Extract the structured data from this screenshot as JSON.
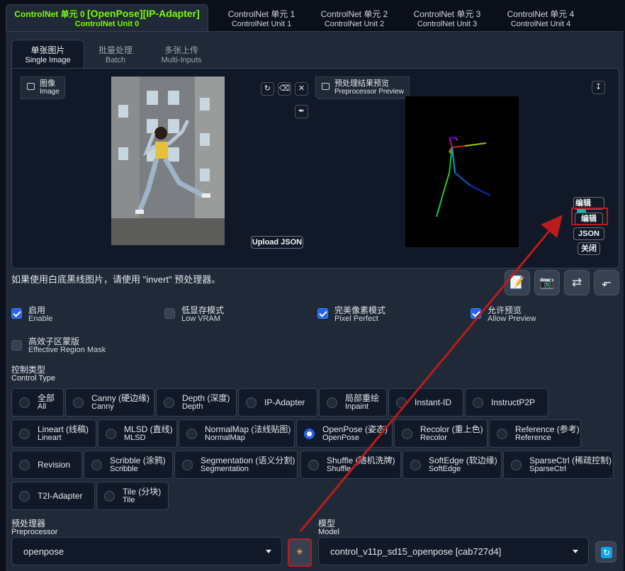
{
  "unit_tabs": [
    {
      "line1": "ControlNet 单元 0",
      "tag": "[OpenPose][IP-Adapter]",
      "line2": "ControlNet Unit 0",
      "active": true
    },
    {
      "line1": "ControlNet 单元 1",
      "line2": "ControlNet Unit 1"
    },
    {
      "line1": "ControlNet 单元 2",
      "line2": "ControlNet Unit 2"
    },
    {
      "line1": "ControlNet 单元 3",
      "line2": "ControlNet Unit 3"
    },
    {
      "line1": "ControlNet 单元 4",
      "line2": "ControlNet Unit 4"
    }
  ],
  "input_tabs": [
    {
      "line1": "单张图片",
      "line2": "Single Image"
    },
    {
      "line1": "批量处理",
      "line2": "Batch"
    },
    {
      "line1": "多张上传",
      "line2": "Multi-Inputs"
    }
  ],
  "image_panel": {
    "label1": "图像",
    "label2": "Image",
    "upload_json": "Upload JSON"
  },
  "preview_panel": {
    "label1": "预处理结果预览",
    "label2": "Preprocessor Preview"
  },
  "preview_buttons": {
    "edit_top": "编辑",
    "edit": "编辑",
    "json": "JSON",
    "close": "关闭"
  },
  "hint": "如果使用白底黑线图片，请使用 \"invert\" 预处理器。",
  "checkboxes": [
    {
      "line1": "启用",
      "line2": "Enable",
      "checked": true
    },
    {
      "line1": "低显存模式",
      "line2": "Low VRAM",
      "checked": false
    },
    {
      "line1": "完美像素模式",
      "line2": "Pixel Perfect",
      "checked": true
    },
    {
      "line1": "允许预览",
      "line2": "Allow Preview",
      "checked": true
    },
    {
      "line1": "高效子区蒙版",
      "line2": "Effective Region Mask",
      "checked": false
    }
  ],
  "control_type": {
    "label1": "控制类型",
    "label2": "Control Type",
    "selected": "OpenPose",
    "options": [
      {
        "line1": "全部",
        "line2": "All"
      },
      {
        "line1": "Canny (硬边缘)",
        "line2": "Canny"
      },
      {
        "line1": "Depth (深度)",
        "line2": "Depth"
      },
      {
        "line1": "IP-Adapter"
      },
      {
        "line1": "局部重绘",
        "line2": "Inpaint"
      },
      {
        "line1": "Instant-ID"
      },
      {
        "line1": "InstructP2P"
      },
      {
        "line1": "Lineart (线稿)",
        "line2": "Lineart"
      },
      {
        "line1": "MLSD (直线)",
        "line2": "MLSD"
      },
      {
        "line1": "NormalMap (法线贴图)",
        "line2": "NormalMap"
      },
      {
        "line1": "OpenPose (姿态)",
        "line2": "OpenPose"
      },
      {
        "line1": "Recolor (重上色)",
        "line2": "Recolor"
      },
      {
        "line1": "Reference (参考)",
        "line2": "Reference"
      },
      {
        "line1": "Revision"
      },
      {
        "line1": "Scribble (涂鸦)",
        "line2": "Scribble"
      },
      {
        "line1": "Segmentation (语义分割)",
        "line2": "Segmentation"
      },
      {
        "line1": "Shuffle (随机洗牌)",
        "line2": "Shuffle"
      },
      {
        "line1": "SoftEdge (软边缘)",
        "line2": "SoftEdge"
      },
      {
        "line1": "SparseCtrl (稀疏控制)",
        "line2": "SparseCtrl"
      },
      {
        "line1": "T2I-Adapter"
      },
      {
        "line1": "Tile (分块)",
        "line2": "Tile"
      }
    ]
  },
  "preprocessor": {
    "label1": "预处理器",
    "label2": "Preprocessor",
    "value": "openpose"
  },
  "model": {
    "label1": "模型",
    "label2": "Model",
    "value": "control_v11p_sd15_openpose [cab727d4]"
  },
  "icons": {
    "run_preprocessor": "explosion-icon",
    "refresh_models": "refresh-icon",
    "annotation_color": "#b91c1c"
  }
}
